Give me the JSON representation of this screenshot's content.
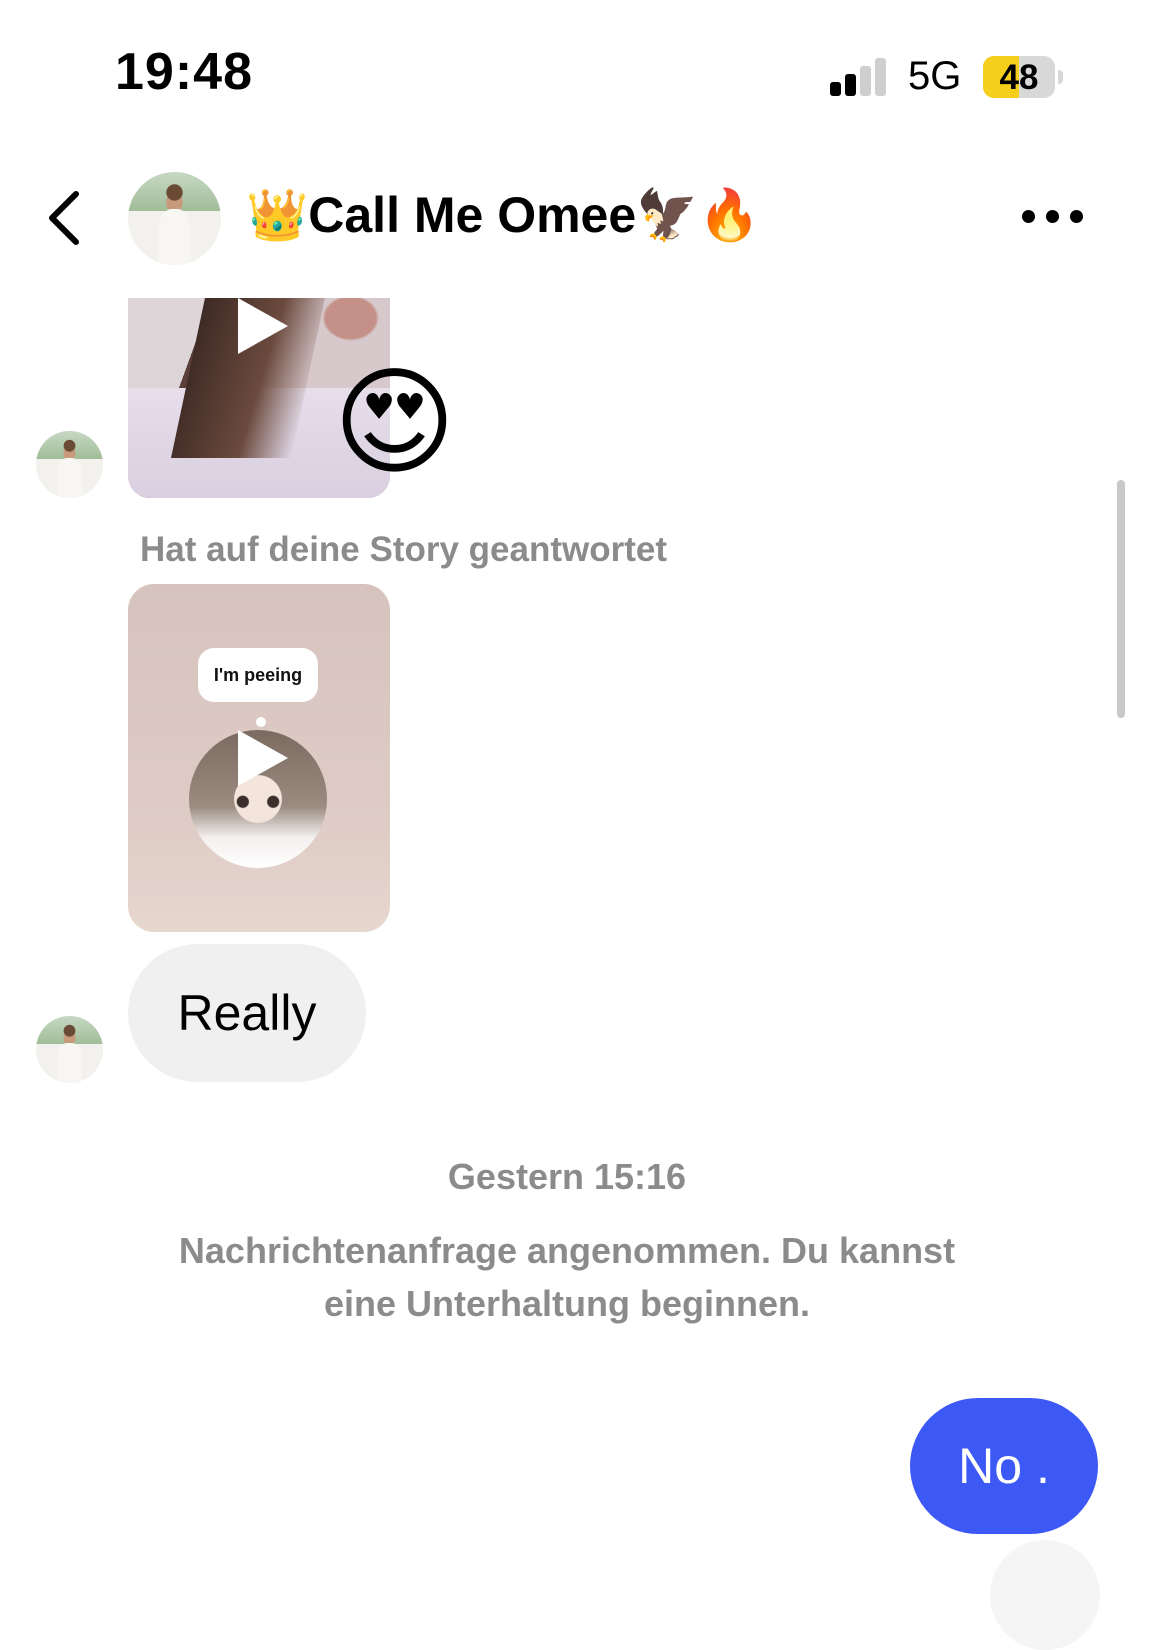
{
  "status_bar": {
    "time": "19:48",
    "network": "5G",
    "battery": "48"
  },
  "header": {
    "back_icon": "chevron-left-icon",
    "contact_name": "👑Call Me Omee🦅🔥",
    "more_icon": "ellipsis-icon"
  },
  "messages": {
    "story_reaction_emoji": "😍",
    "reply_label": "Hat auf deine Story geantwortet",
    "story_sticker_text": "I'm peeing",
    "incoming_text": "Really",
    "timestamp": "Gestern 15:16",
    "notice": "Nachrichtenanfrage angenommen. Du kannst eine Unterhaltung beginnen.",
    "outgoing_text": "No ."
  },
  "colors": {
    "outgoing_bubble": "#3d59f5",
    "incoming_bubble": "#f0f0f0",
    "battery_fill": "#f6cf1c",
    "meta_text": "#8b8b8b"
  }
}
